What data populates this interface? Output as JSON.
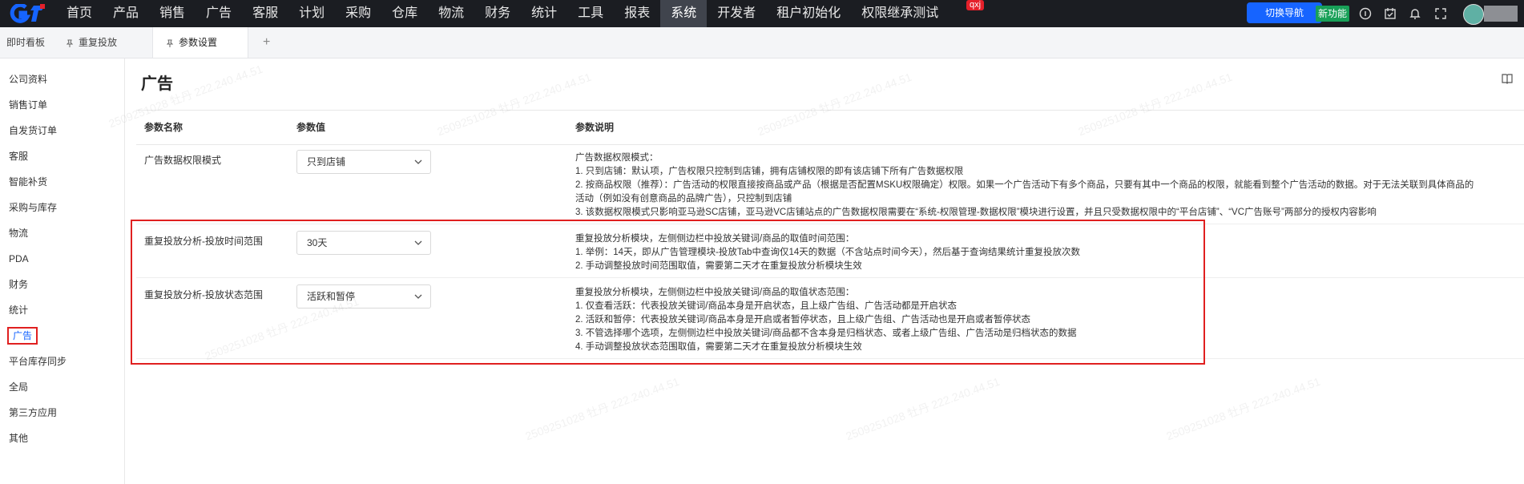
{
  "topbar": {
    "nav": [
      "首页",
      "产品",
      "销售",
      "广告",
      "客服",
      "计划",
      "采购",
      "仓库",
      "物流",
      "财务",
      "统计",
      "工具",
      "报表",
      "系统",
      "开发者",
      "租户初始化",
      "权限继承测试"
    ],
    "active_nav": "系统",
    "qx_badge": "qxj",
    "switch_nav_label": "切换导航",
    "new_feature_label": "新功能",
    "icons": [
      "info-icon",
      "calendar-check-icon",
      "bell-icon",
      "fullscreen-icon"
    ]
  },
  "tabs": {
    "items": [
      "即时看板",
      "重复投放",
      "参数设置"
    ],
    "active": "参数设置",
    "add_label": "+"
  },
  "sidebar": {
    "items": [
      "公司资料",
      "销售订单",
      "自发货订单",
      "客服",
      "智能补货",
      "采购与库存",
      "物流",
      "PDA",
      "财务",
      "统计",
      "广告",
      "平台库存同步",
      "全局",
      "第三方应用",
      "其他"
    ],
    "active": "广告"
  },
  "main": {
    "title": "广告",
    "columns": [
      "参数名称",
      "参数值",
      "参数说明"
    ],
    "rows": [
      {
        "name": "广告数据权限模式",
        "value": "只到店铺",
        "desc": [
          "广告数据权限模式：",
          "1. 只到店铺：默认项，广告权限只控制到店铺，拥有店铺权限的即有该店铺下所有广告数据权限",
          "2. 按商品权限（推荐）：广告活动的权限直接按商品或产品（根据是否配置MSKU权限确定）权限。如果一个广告活动下有多个商品，只要有其中一个商品的权限，就能看到整个广告活动的数据。对于无法关联到具体商品的",
          "活动（例如没有创意商品的品牌广告），只控制到店铺",
          "3. 该数据权限模式只影响亚马逊SC店铺，亚马逊VC店铺站点的广告数据权限需要在“系统-权限管理-数据权限”模块进行设置，并且只受数据权限中的“平台店铺”、“VC广告账号”两部分的授权内容影响"
        ]
      },
      {
        "name": "重复投放分析-投放时间范围",
        "value": "30天",
        "desc": [
          "重复投放分析模块，左侧侧边栏中投放关键词/商品的取值时间范围：",
          "1. 举例：14天，即从广告管理模块-投放Tab中查询仅14天的数据（不含站点时间今天），然后基于查询结果统计重复投放次数",
          "2. 手动调整投放时间范围取值，需要第二天才在重复投放分析模块生效"
        ]
      },
      {
        "name": "重复投放分析-投放状态范围",
        "value": "活跃和暂停",
        "desc": [
          "重复投放分析模块，左侧侧边栏中投放关键词/商品的取值状态范围：",
          "1. 仅查看活跃：代表投放关键词/商品本身是开启状态，且上级广告组、广告活动都是开启状态",
          "2. 活跃和暂停：代表投放关键词/商品本身是开启或者暂停状态，且上级广告组、广告活动也是开启或者暂停状态",
          "3. 不管选择哪个选项，左侧侧边栏中投放关键词/商品都不含本身是归档状态、或者上级广告组、广告活动是归档状态的数据",
          "4. 手动调整投放状态范围取值，需要第二天才在重复投放分析模块生效"
        ]
      }
    ]
  },
  "watermark": "2509251028 牡丹 222.240.44.51",
  "colors": {
    "topbar": "#1b1d22",
    "accent": "#1664ff",
    "new_feature": "#18a058",
    "highlight": "#e02020"
  }
}
